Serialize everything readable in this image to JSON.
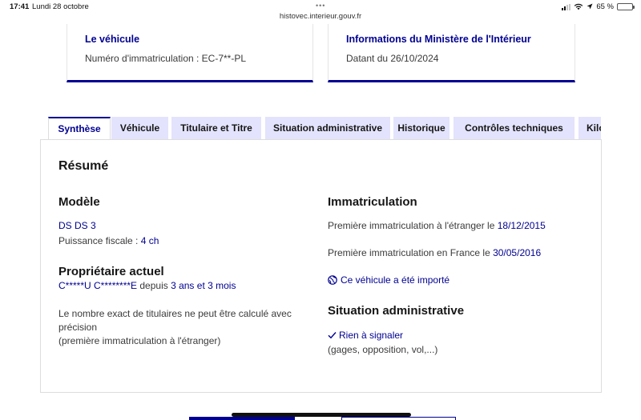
{
  "status_bar": {
    "time": "17:41",
    "date": "Lundi 28 octobre",
    "url": "histovec.interieur.gouv.fr",
    "battery": "65 %",
    "battery_level_percent": 65
  },
  "cards": {
    "vehicle": {
      "title": "Le véhicule",
      "text": "Numéro d'immatriculation : EC-7**-PL"
    },
    "ministry": {
      "title": "Informations du Ministère de l'Intérieur",
      "text": "Datant du 26/10/2024"
    }
  },
  "tabs": [
    {
      "label": "Synthèse",
      "active": true
    },
    {
      "label": "Véhicule",
      "active": false
    },
    {
      "label": "Titulaire et Titre",
      "active": false
    },
    {
      "label": "Situation administrative",
      "active": false
    },
    {
      "label": "Historique",
      "active": false
    },
    {
      "label": "Contrôles techniques",
      "active": false
    },
    {
      "label": "Kilo",
      "active": false
    }
  ],
  "summary": {
    "title": "Résumé",
    "model": {
      "heading": "Modèle",
      "name": "DS DS 3",
      "power_label": "Puissance fiscale : ",
      "power_value": "4 ch"
    },
    "owner": {
      "heading": "Propriétaire actuel",
      "name": "C*****U C********E",
      "since_label": " depuis ",
      "since_value": "3 ans et 3 mois",
      "note_line1": "Le nombre exact de titulaires ne peut être calculé avec",
      "note_line2": "précision",
      "note_line3": "(première immatriculation à l'étranger)"
    },
    "registration": {
      "heading": "Immatriculation",
      "foreign_label": "Première immatriculation à l'étranger le ",
      "foreign_date": "18/12/2015",
      "france_label": "Première immatriculation en France le ",
      "france_date": "30/05/2016",
      "imported": "Ce véhicule a été importé"
    },
    "admin": {
      "heading": "Situation administrative",
      "status": "Rien à signaler",
      "details": "(gages, opposition, vol,...)"
    }
  }
}
